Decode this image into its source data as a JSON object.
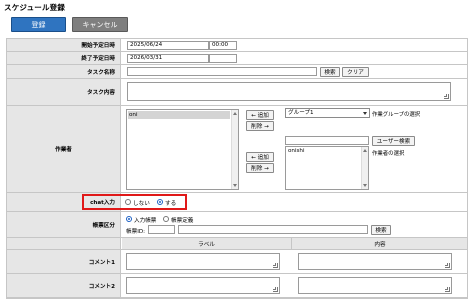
{
  "window": {
    "title": "スケジュール登録"
  },
  "toolbar": {
    "register_label": "登録",
    "cancel_label": "キャンセル"
  },
  "form": {
    "start_date": {
      "label": "開始予定日時",
      "date": "2025/06/24",
      "time": "00:00"
    },
    "end_date": {
      "label": "終了予定日時",
      "date": "2026/03/31",
      "time": ""
    },
    "task_name": {
      "label": "タスク名称",
      "value": "",
      "search_label": "検索",
      "clear_label": "クリア"
    },
    "task_content": {
      "label": "タスク内容",
      "value": ""
    },
    "workers": {
      "label": "作業者",
      "selected_list": [
        "oni"
      ],
      "add_label": "← 追加",
      "remove_label": "削除 →",
      "group_select_value": "グループ1",
      "group_select_note": "作業グループの選択",
      "user_search_label": "ユーザー検索",
      "user_list": [
        "onishi"
      ],
      "user_select_note": "作業者の選択"
    },
    "chat_input": {
      "label": "chat入力",
      "option_no": "しない",
      "option_yes": "する",
      "selected": "する"
    },
    "form_type": {
      "label": "帳票区分",
      "option_input": "入力帳票",
      "option_definition": "帳票定義",
      "selected": "入力帳票",
      "form_id_label": "帳票ID:",
      "form_id_value": "",
      "search_label": "検索"
    },
    "comments_header": {
      "label_col": "ラベル",
      "content_col": "内容"
    },
    "comments": [
      {
        "label": "コメント1",
        "label_value": "",
        "content_value": ""
      },
      {
        "label": "コメント2",
        "label_value": "",
        "content_value": ""
      }
    ]
  }
}
